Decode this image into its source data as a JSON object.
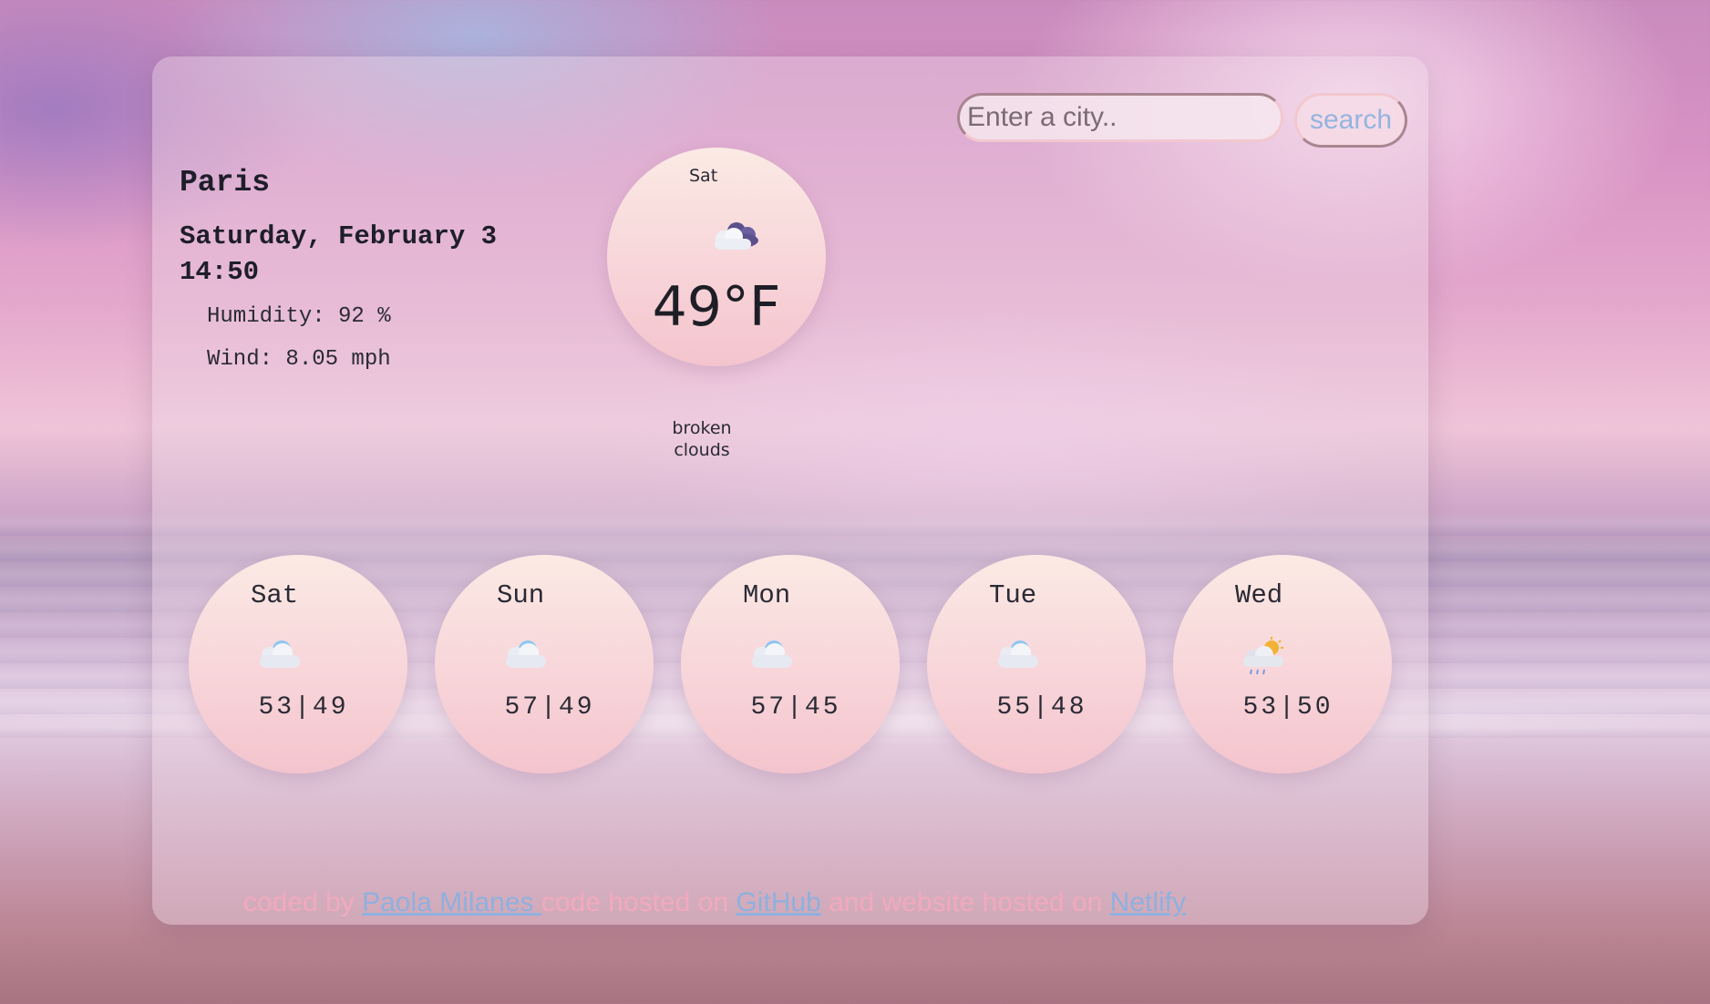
{
  "search": {
    "placeholder": "Enter a city..",
    "button_label": "search"
  },
  "current": {
    "city": "Paris",
    "date": "Saturday, February 3",
    "time": "14:50",
    "humidity": "Humidity: 92 %",
    "wind": "Wind: 8.05 mph",
    "day": "Sat",
    "temperature": "49°F",
    "description": "broken clouds",
    "icon": "broken-clouds-icon"
  },
  "forecast": [
    {
      "day": "Sat",
      "temps": "53|49",
      "icon": "cloud-icon"
    },
    {
      "day": "Sun",
      "temps": "57|49",
      "icon": "cloud-icon"
    },
    {
      "day": "Mon",
      "temps": "57|45",
      "icon": "cloud-icon"
    },
    {
      "day": "Tue",
      "temps": "55|48",
      "icon": "cloud-icon"
    },
    {
      "day": "Wed",
      "temps": "53|50",
      "icon": "sun-rain-cloud-icon"
    }
  ],
  "footer": {
    "prefix": "coded by ",
    "author_link": "Paola Milanes ",
    "middle1": "code hosted on ",
    "github_link": "GitHub",
    "middle2": " and website hosted on ",
    "netlify_link": "Netlify"
  },
  "colors": {
    "accent_blue": "#8fb0df",
    "footer_pink": "#f2a9bd"
  }
}
